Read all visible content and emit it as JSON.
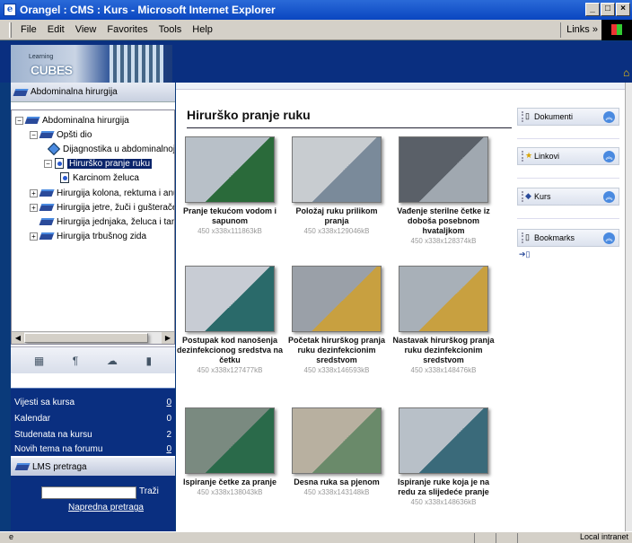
{
  "window": {
    "title": "Orangel : CMS : Kurs - Microsoft Internet Explorer",
    "links": "Links"
  },
  "menu": [
    "File",
    "Edit",
    "View",
    "Favorites",
    "Tools",
    "Help"
  ],
  "logo": {
    "top": "Learning",
    "bottom": "CUBES"
  },
  "course_header": "Abdominalna hirurgija",
  "tree": {
    "root": "Abdominalna hirurgija",
    "n1": "Opšti dio",
    "n1a": "Dijagnostika u abdominalnoj h",
    "n1b": "Hirurško pranje ruku",
    "n1b1": "Karcinom želuca",
    "n2": "Hirurgija kolona, rektuma i anusa",
    "n3": "Hirurgija jetre, žuči i gušterače",
    "n4": "Hirurgija jednjaka, želuca i tankog",
    "n5": "Hirurgija trbušnog zida"
  },
  "stats": [
    {
      "label": "Vijesti sa kursa",
      "value": "0"
    },
    {
      "label": "Kalendar",
      "value": "0"
    },
    {
      "label": "Studenata na kursu",
      "value": "2"
    },
    {
      "label": "Novih tema na forumu",
      "value": "0"
    }
  ],
  "lms": {
    "title": "LMS pretraga",
    "search_button": "Traži",
    "advanced": "Napredna pretraga"
  },
  "page_title": "Hirurško pranje ruku",
  "gallery": [
    {
      "caption": "Pranje tekućom vodom i sapunom",
      "meta": "450 x338x111863kB"
    },
    {
      "caption": "Položaj ruku prilikom pranja",
      "meta": "450 x338x129046kB"
    },
    {
      "caption": "Vađenje sterilne četke iz doboša posebnom hvataljkom",
      "meta": "450 x338x128374kB"
    },
    {
      "caption": "Postupak kod nanošenja dezinfekcionog sredstva na četku",
      "meta": "450 x338x127477kB"
    },
    {
      "caption": "Početak hirurškog pranja ruku dezinfekcionim sredstvom",
      "meta": "450 x338x146593kB"
    },
    {
      "caption": "Nastavak hirurškog pranja ruku dezinfekcionim sredstvom",
      "meta": "450 x338x148476kB"
    },
    {
      "caption": "Ispiranje četke za pranje",
      "meta": "450 x338x138043kB"
    },
    {
      "caption": "Desna ruka sa pjenom",
      "meta": "450 x338x143148kB"
    },
    {
      "caption": "Ispiranje ruke koja je na redu za slijedeće pranje",
      "meta": "450 x338x148636kB"
    }
  ],
  "side_panels": [
    "Dokumenti",
    "Linkovi",
    "Kurs",
    "Bookmarks"
  ],
  "status": {
    "zone": "Local intranet"
  }
}
